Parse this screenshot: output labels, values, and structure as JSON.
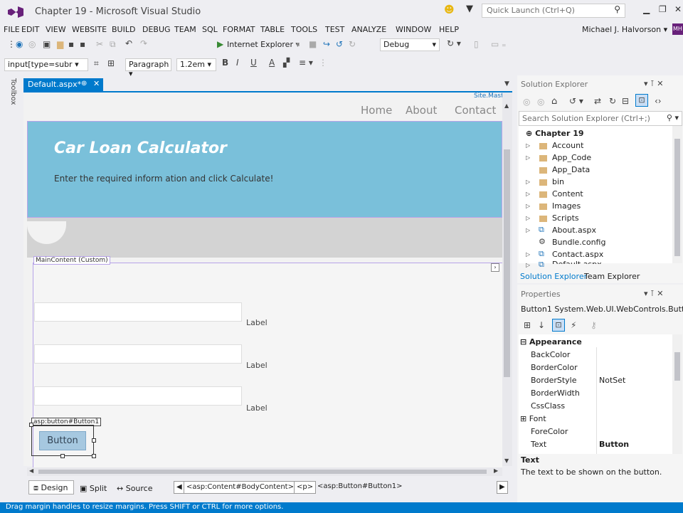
{
  "window": {
    "title": "Chapter 19 - Microsoft Visual Studio",
    "quick_launch_placeholder": "Quick Launch (Ctrl+Q)"
  },
  "menu": [
    "FILE",
    "EDIT",
    "VIEW",
    "WEBSITE",
    "BUILD",
    "DEBUG",
    "TEAM",
    "SQL",
    "FORMAT",
    "TABLE",
    "TOOLS",
    "TEST",
    "ANALYZE",
    "WINDOW",
    "HELP"
  ],
  "user": {
    "name": "Michael J. Halvorson",
    "initials": "MH"
  },
  "toolbar": {
    "browser": "Internet Explorer",
    "config": "Debug"
  },
  "format_toolbar": {
    "selector": "input[type=subr",
    "block": "Paragraph",
    "size": "1.2em"
  },
  "toolbox": "Toolbox",
  "document": {
    "tab": "Default.aspx*",
    "master": "Site.Master"
  },
  "page": {
    "nav": [
      "Home",
      "About",
      "Contact"
    ],
    "title": "Car Loan Calculator",
    "subtitle": "Enter the required inform ation and click Calculate!",
    "content_tag": "MainContent (Custom)",
    "labels": [
      "Label",
      "Label",
      "Label"
    ],
    "button_tag": "asp:button#Button1",
    "button_text": "Button"
  },
  "views": {
    "design": "Design",
    "split": "Split",
    "source": "Source"
  },
  "breadcrumbs": [
    "<asp:Content#BodyContent>",
    "<p>",
    "<asp:Button#Button1>"
  ],
  "solution_explorer": {
    "title": "Solution Explorer",
    "search_placeholder": "Search Solution Explorer (Ctrl+;)",
    "root": "Chapter 19",
    "items": [
      "Account",
      "App_Code",
      "App_Data",
      "bin",
      "Content",
      "Images",
      "Scripts",
      "About.aspx",
      "Bundle.config",
      "Contact.aspx",
      "Default.aspx"
    ],
    "tabs": [
      "Solution Explorer",
      "Team Explorer"
    ]
  },
  "properties": {
    "title": "Properties",
    "object": "Button1  System.Web.UI.WebControls.Butt",
    "category_appearance": "Appearance",
    "rows": [
      {
        "name": "BackColor",
        "value": ""
      },
      {
        "name": "BorderColor",
        "value": ""
      },
      {
        "name": "BorderStyle",
        "value": "NotSet"
      },
      {
        "name": "BorderWidth",
        "value": ""
      },
      {
        "name": "CssClass",
        "value": ""
      },
      {
        "name": "Font",
        "value": ""
      },
      {
        "name": "ForeColor",
        "value": ""
      },
      {
        "name": "Text",
        "value": "Button"
      }
    ],
    "desc_title": "Text",
    "desc_text": "The text to be shown on the button."
  },
  "status": "Drag margin handles to resize margins. Press SHIFT or CTRL for more options.",
  "colors": {
    "accent": "#007acc",
    "banner": "#7ac0da",
    "status": "#007acc"
  }
}
